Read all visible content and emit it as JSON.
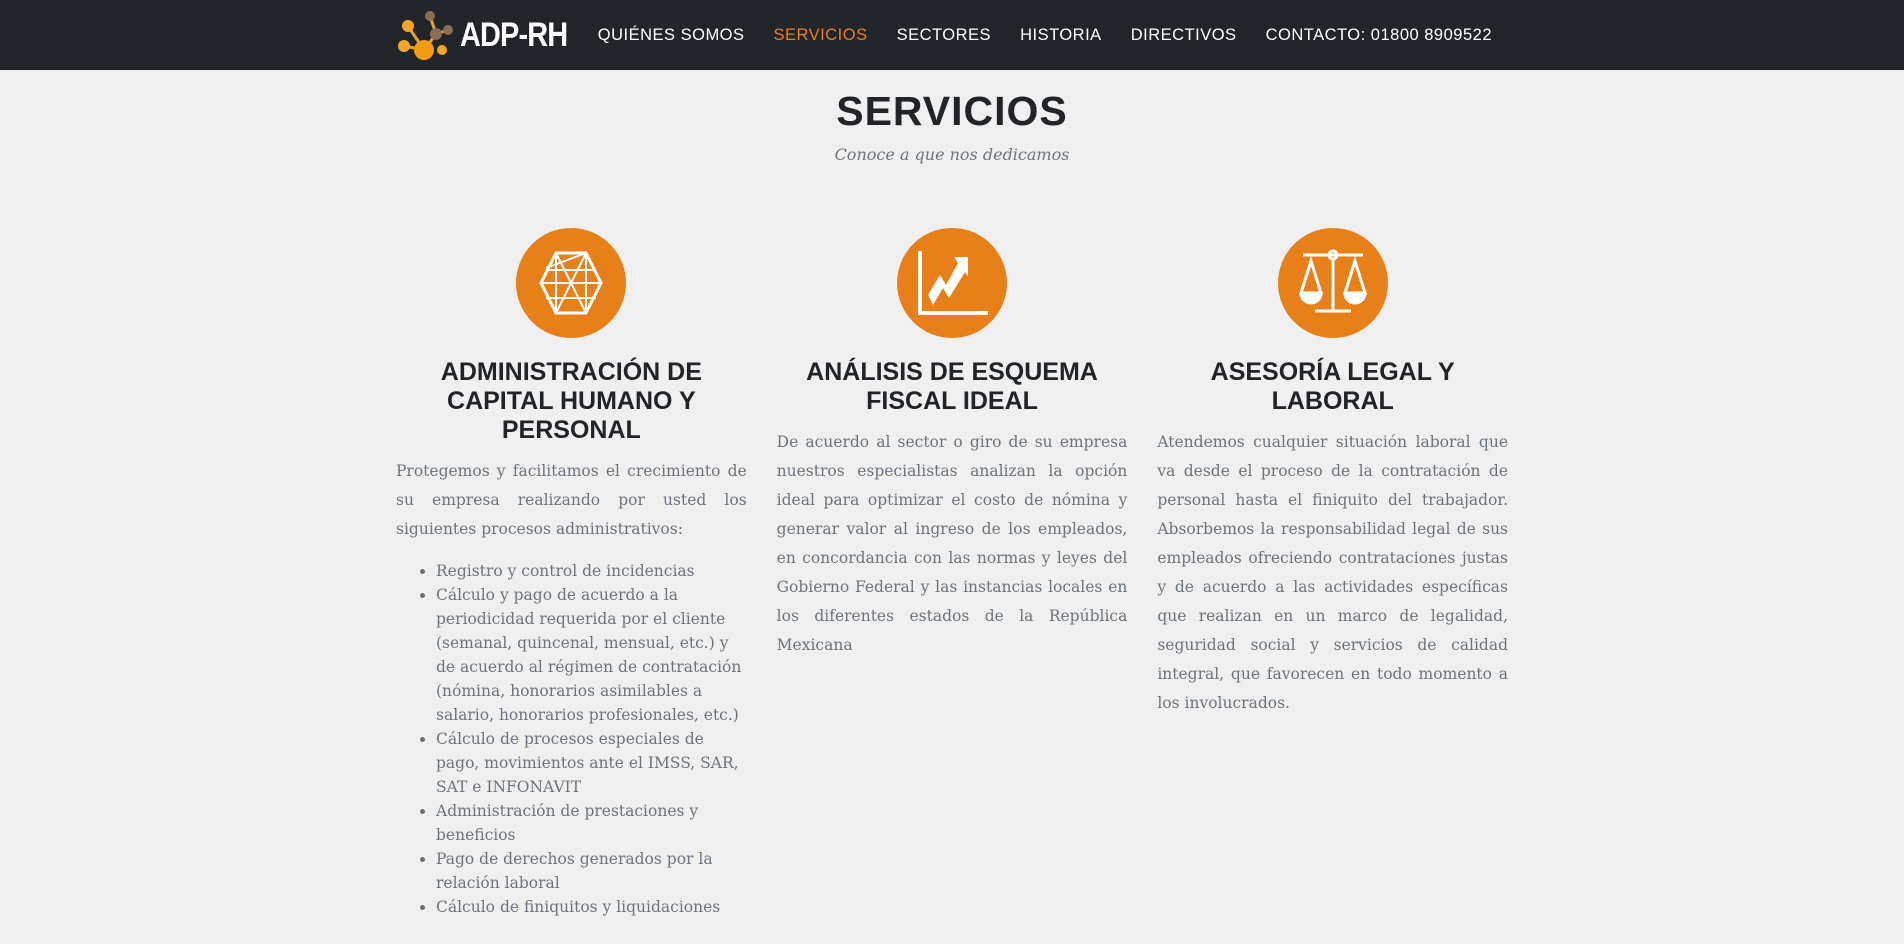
{
  "nav": {
    "logo_text": "ADP-RH",
    "items": [
      {
        "label": "QUIÉNES SOMOS",
        "active": false
      },
      {
        "label": "SERVICIOS",
        "active": true
      },
      {
        "label": "SECTORES",
        "active": false
      },
      {
        "label": "HISTORIA",
        "active": false
      },
      {
        "label": "DIRECTIVOS",
        "active": false
      },
      {
        "label": "CONTACTO: 01800 8909522",
        "active": false
      }
    ]
  },
  "header": {
    "title": "SERVICIOS",
    "subtitle": "Conoce a que nos dedicamos"
  },
  "colors": {
    "accent": "#e8801a",
    "nav_bg": "#212529"
  },
  "services": [
    {
      "icon": "network-hexagon-icon",
      "title": "ADMINISTRACIÓN DE CAPITAL HUMANO Y PERSONAL",
      "text": "Protegemos y facilitamos el crecimiento de su empresa realizando por usted los siguientes procesos administrativos:",
      "list": [
        "Registro y control de incidencias",
        "Cálculo y pago de acuerdo a la periodicidad requerida por el cliente (semanal, quincenal, mensual, etc.) y de acuerdo al régimen de contratación (nómina, honorarios asimilables a salario, honorarios profesionales, etc.)",
        "Cálculo de procesos especiales de pago, movimientos ante el IMSS, SAR, SAT e INFONAVIT",
        "Administración de prestaciones y beneficios",
        "Pago de derechos generados por la relación laboral",
        "Cálculo de finiquitos y liquidaciones"
      ]
    },
    {
      "icon": "chart-trend-up-icon",
      "title": "ANÁLISIS DE ESQUEMA FISCAL IDEAL",
      "text": "De acuerdo al sector o giro de su empresa nuestros especialistas analizan la opción ideal para optimizar el costo de nómina y generar valor al ingreso de los empleados, en concordancia con las normas y leyes del Gobierno Federal y las instancias locales en los diferentes estados de la República Mexicana"
    },
    {
      "icon": "scales-icon",
      "title": "ASESORÍA LEGAL Y LABORAL",
      "text": "Atendemos cualquier situación laboral que va desde el proceso de la contratación de personal hasta el finiquito del trabajador. Absorbemos la responsabilidad legal de sus empleados ofreciendo contrataciones justas y de acuerdo a las actividades específicas que realizan en un marco de legalidad, seguridad social y servicios de calidad integral, que favorecen en todo momento a los involucrados."
    }
  ]
}
